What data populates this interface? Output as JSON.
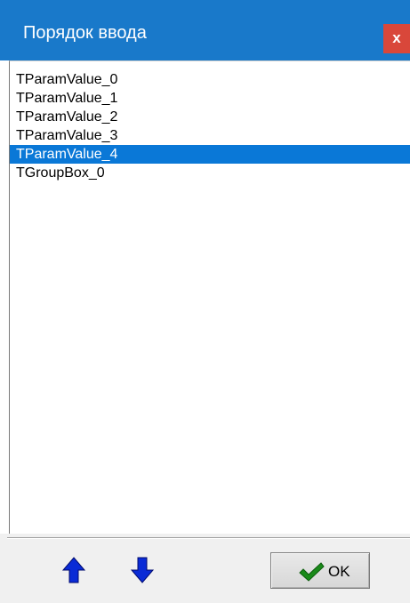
{
  "window": {
    "title": "Порядок ввода",
    "close_label": "x"
  },
  "list": {
    "items": [
      {
        "label": "TParamValue_0",
        "selected": false
      },
      {
        "label": "TParamValue_1",
        "selected": false
      },
      {
        "label": "TParamValue_2",
        "selected": false
      },
      {
        "label": "TParamValue_3",
        "selected": false
      },
      {
        "label": "TParamValue_4",
        "selected": true
      },
      {
        "label": "TGroupBox_0",
        "selected": false
      }
    ]
  },
  "toolbar": {
    "move_up_icon": "arrow-up-icon",
    "move_down_icon": "arrow-down-icon",
    "ok_icon": "checkmark-icon",
    "ok_label": "OK"
  },
  "colors": {
    "titlebar": "#1979ca",
    "selection": "#0a78d7",
    "close": "#d9473a",
    "arrow": "#0a2bd6",
    "check": "#1a8a1a"
  }
}
